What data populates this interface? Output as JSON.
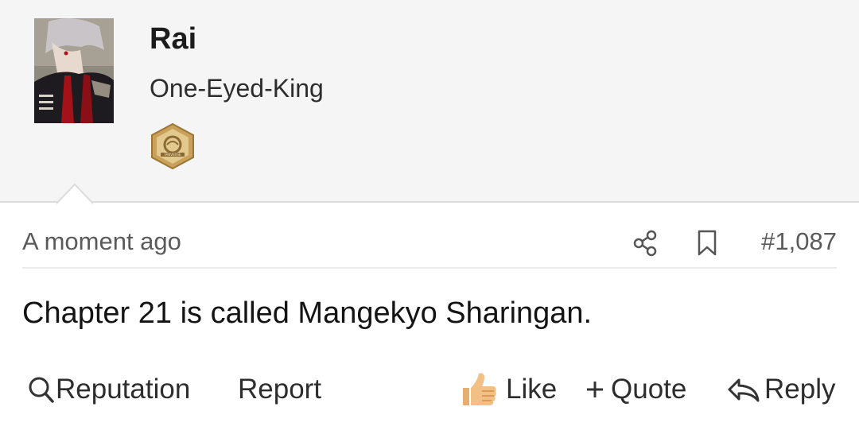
{
  "user": {
    "name": "Rai",
    "title": "One-Eyed-King",
    "badge_text": "FANVERSE"
  },
  "post": {
    "timestamp": "A moment ago",
    "number": "#1,087",
    "message": "Chapter 21 is called Mangekyo Sharingan."
  },
  "actions": {
    "reputation": "Reputation",
    "report": "Report",
    "like": "Like",
    "quote": "Quote",
    "reply": "Reply"
  },
  "icons": {
    "share": "share-icon",
    "bookmark": "bookmark-icon",
    "search": "search-icon",
    "thumbs_up": "thumbs-up-icon",
    "plus": "plus-icon",
    "reply": "reply-arrow-icon"
  },
  "colors": {
    "user_block_bg": "#f5f5f5",
    "text": "#141414",
    "muted": "#5a5a5a",
    "badge_gold": "#c9a15a"
  }
}
